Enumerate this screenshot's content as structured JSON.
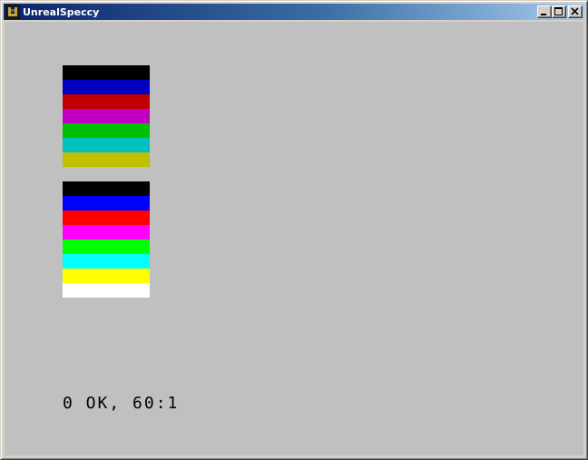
{
  "window": {
    "title": "UnrealSpeccy",
    "icon": "unrealspeccy-app-icon",
    "buttons": [
      {
        "name": "minimize",
        "icon": "minimize-icon"
      },
      {
        "name": "maximize",
        "icon": "maximize-icon"
      },
      {
        "name": "close",
        "icon": "close-icon"
      }
    ]
  },
  "screen": {
    "border_color": "#c0c0c0",
    "palette_normal": [
      "#000000",
      "#0000c0",
      "#c00000",
      "#c000c0",
      "#00c000",
      "#00c0c0",
      "#c0c000"
    ],
    "palette_bright": [
      "#000000",
      "#0000ff",
      "#ff0000",
      "#ff00ff",
      "#00ff00",
      "#00ffff",
      "#ffff00",
      "#ffffff"
    ],
    "status_message": "0 OK, 60:1"
  }
}
